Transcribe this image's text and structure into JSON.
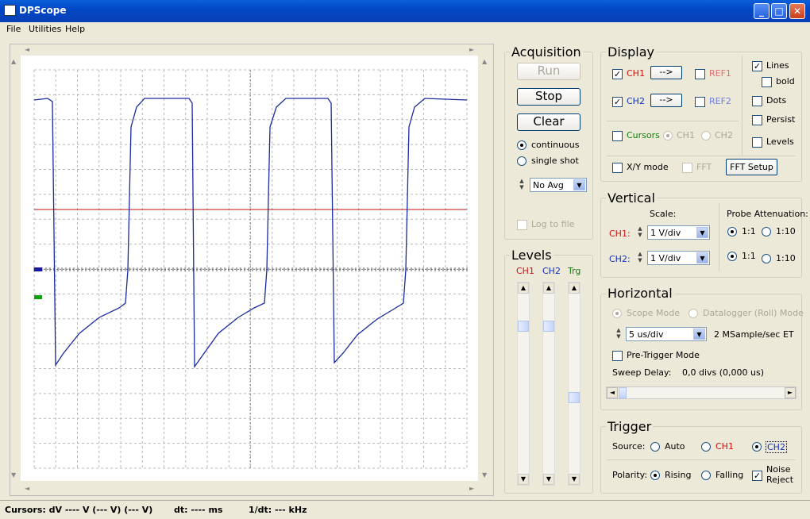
{
  "window": {
    "title": "DPScope"
  },
  "menu": [
    "File",
    "Utilities",
    "Help"
  ],
  "acquisition": {
    "title": "Acquisition",
    "run": "Run",
    "stop": "Stop",
    "clear": "Clear",
    "continuous": "continuous",
    "single_shot": "single shot",
    "avg": "No Avg",
    "log": "Log to file"
  },
  "display": {
    "title": "Display",
    "ch1": "CH1",
    "ch2": "CH2",
    "arrow": "-->",
    "ref1": "REF1",
    "ref2": "REF2",
    "lines": "Lines",
    "bold": "bold",
    "dots": "Dots",
    "persist": "Persist",
    "levels": "Levels",
    "cursors": "Cursors",
    "cur_ch1": "CH1",
    "cur_ch2": "CH2",
    "xy": "X/Y mode",
    "fft": "FFT",
    "fft_setup": "FFT Setup"
  },
  "vertical": {
    "title": "Vertical",
    "scale": "Scale:",
    "probe": "Probe Attenuation:",
    "ch1": "CH1:",
    "ch2": "CH2:",
    "ch1_scale": "1 V/div",
    "ch2_scale": "1 V/div",
    "r1": "1:1",
    "r10": "1:10"
  },
  "horizontal": {
    "title": "Horizontal",
    "scope_mode": "Scope Mode",
    "datalogger": "Datalogger (Roll) Mode",
    "timebase": "5 us/div",
    "rate": "2 MSample/sec ET",
    "pretrigger": "Pre-Trigger Mode",
    "sweep_label": "Sweep Delay:",
    "sweep_value": "0,0 divs (0,000 us)"
  },
  "trigger": {
    "title": "Trigger",
    "source": "Source:",
    "auto": "Auto",
    "ch1": "CH1",
    "ch2": "CH2",
    "polarity": "Polarity:",
    "rising": "Rising",
    "falling": "Falling",
    "noise1": "Noise",
    "noise2": "Reject"
  },
  "levels": {
    "title": "Levels",
    "ch1": "CH1",
    "ch2": "CH2",
    "trg": "Trg"
  },
  "status": {
    "cursors": "Cursors: dV ---- V  (--- V) (--- V)",
    "dt": "dt: ---- ms",
    "inv": "1/dt: --- kHz"
  },
  "colors": {
    "ch1": "#d01010",
    "ch2": "#1010a0",
    "trigger_marker": "#10a010"
  },
  "icons": {
    "up": "▲",
    "down": "▼",
    "left": "◄",
    "right": "►",
    "check": "✓"
  }
}
